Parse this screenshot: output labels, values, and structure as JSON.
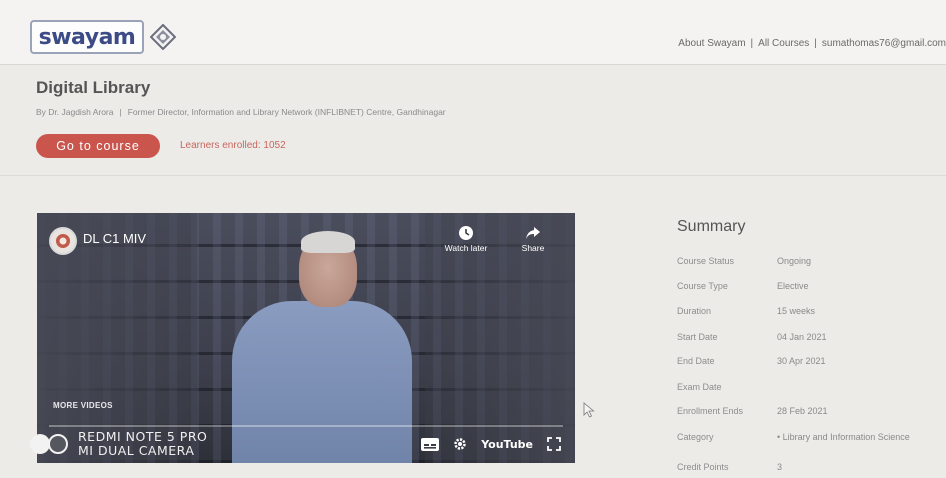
{
  "header": {
    "logo_text": "swayam",
    "nav": {
      "about": "About Swayam",
      "all_courses": "All Courses",
      "user_email": "sumathomas76@gmail.com"
    }
  },
  "course": {
    "title": "Digital Library",
    "byline_author": "By Dr. Jagdish Arora",
    "byline_role": "Former Director, Information and Library Network (INFLIBNET) Centre, Gandhinagar",
    "go_button": "Go to course",
    "learners_enrolled": "Learners enrolled: 1052"
  },
  "video": {
    "channel_title": "DL C1 MIV",
    "watch_later": "Watch later",
    "share": "Share",
    "more_videos": "MORE VIDEOS",
    "youtube_label": "YouTube",
    "watermark_line1": "REDMI NOTE 5 PRO",
    "watermark_line2": "MI DUAL CAMERA"
  },
  "summary": {
    "title": "Summary",
    "rows": [
      {
        "label": "Course Status",
        "value": "Ongoing"
      },
      {
        "label": "Course Type",
        "value": "Elective"
      },
      {
        "label": "Duration",
        "value": "15 weeks"
      },
      {
        "label": "Start Date",
        "value": "04 Jan 2021"
      },
      {
        "label": "End Date",
        "value": "30 Apr 2021"
      },
      {
        "label": "Exam Date",
        "value": ""
      },
      {
        "label": "Enrollment Ends",
        "value": "28 Feb 2021"
      },
      {
        "label": "Category",
        "value": "Library and Information Science"
      },
      {
        "label": "Credit Points",
        "value": "3"
      }
    ]
  }
}
